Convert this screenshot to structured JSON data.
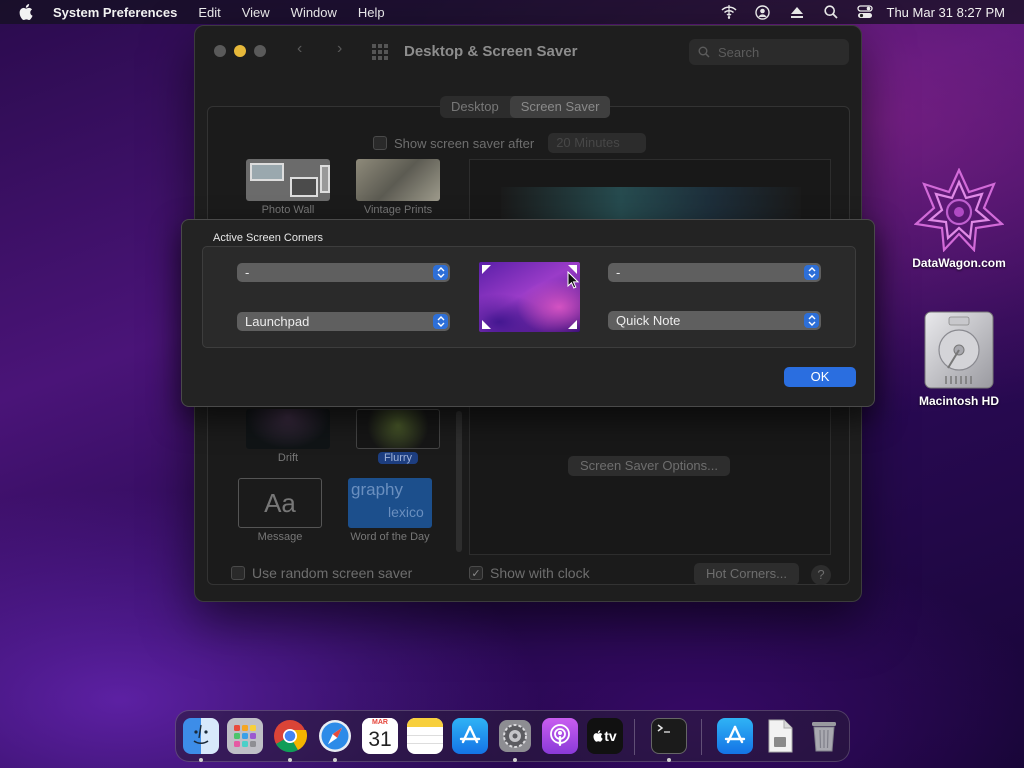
{
  "menubar": {
    "app_name": "System Preferences",
    "menus": [
      "Edit",
      "View",
      "Window",
      "Help"
    ],
    "clock": "Thu Mar 31  8:27 PM",
    "status_icons": [
      "wifi-off-icon",
      "user-icon",
      "eject-icon",
      "search-icon",
      "control-center-icon"
    ]
  },
  "desktop": {
    "icons": [
      {
        "label": "DataWagon.com",
        "icon": "datawagon-logo-icon"
      },
      {
        "label": "Macintosh HD",
        "icon": "hard-drive-icon"
      }
    ]
  },
  "window": {
    "title": "Desktop & Screen Saver",
    "search_placeholder": "Search",
    "tabs": [
      {
        "label": "Desktop",
        "active": false
      },
      {
        "label": "Screen Saver",
        "active": true
      }
    ],
    "show_after": {
      "label": "Show screen saver after",
      "checked": false,
      "value": "20 Minutes"
    },
    "screen_savers": [
      {
        "label": "Photo Wall",
        "selected": false
      },
      {
        "label": "Vintage Prints",
        "selected": false
      },
      {
        "label": "Drift",
        "selected": false
      },
      {
        "label": "Flurry",
        "selected": true
      },
      {
        "label": "Message",
        "selected": false,
        "preview_text": "Aa"
      },
      {
        "label": "Word of the Day",
        "selected": false,
        "preview_text": "graphy",
        "preview_sub": "lexico"
      }
    ],
    "options_button": "Screen Saver Options...",
    "random_saver": {
      "label": "Use random screen saver",
      "checked": false
    },
    "show_clock": {
      "label": "Show with clock",
      "checked": true
    },
    "hot_corners_button": "Hot Corners...",
    "help_button": "?"
  },
  "sheet": {
    "title": "Active Screen Corners",
    "top_left": "-",
    "top_right": "-",
    "bottom_left": "Launchpad",
    "bottom_right": "Quick Note",
    "ok_button": "OK"
  },
  "dock": {
    "items": [
      "finder-icon",
      "launchpad-icon",
      "chrome-icon",
      "safari-icon",
      "calendar-icon",
      "notes-icon",
      "app-store-icon",
      "system-preferences-icon",
      "podcasts-icon",
      "apple-tv-icon",
      "terminal-icon",
      "app-store-downloads-icon",
      "document-icon",
      "trash-icon"
    ],
    "calendar_month": "MAR",
    "calendar_day": "31",
    "tv_label": "tv"
  }
}
